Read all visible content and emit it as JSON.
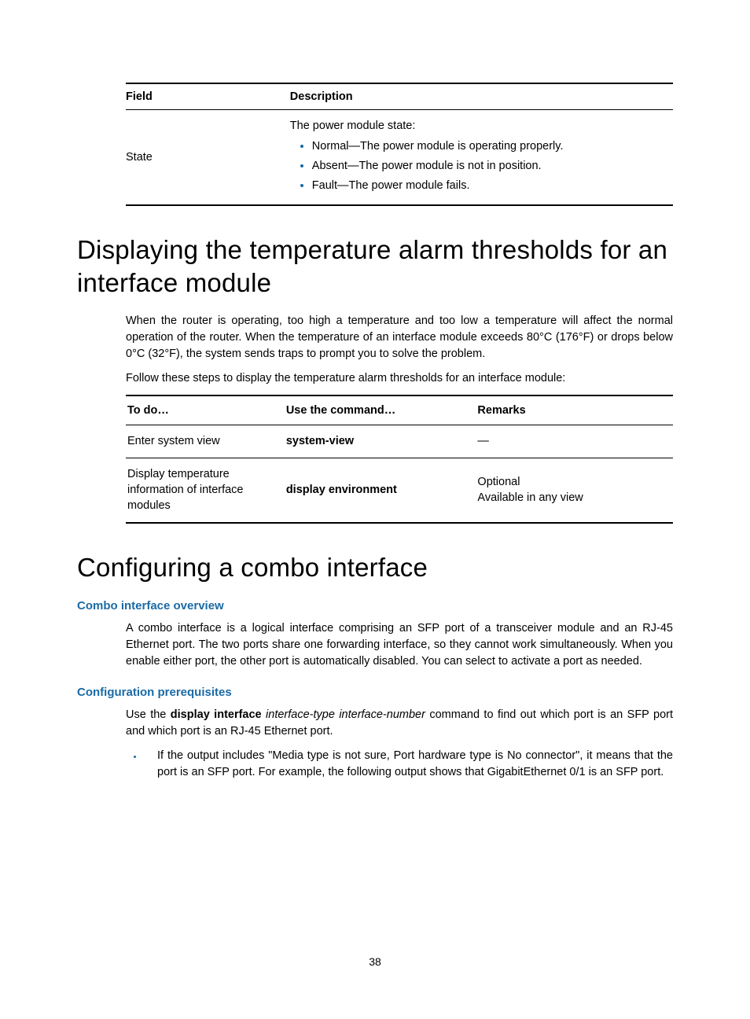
{
  "table1": {
    "headers": {
      "field": "Field",
      "description": "Description"
    },
    "row": {
      "field": "State",
      "intro": "The power module state:",
      "items": [
        "Normal—The power module is operating properly.",
        "Absent—The power module is not in position.",
        "Fault—The power module fails."
      ]
    }
  },
  "h1_temp": "Displaying the temperature alarm thresholds for an interface module",
  "temp_para": "When the router is operating, too high a temperature and too low a temperature will affect the normal operation of the router. When the temperature of an interface module exceeds 80°C (176°F) or drops below 0°C (32°F), the system sends traps to prompt you to solve the problem.",
  "temp_steps_intro": "Follow these steps to display the temperature alarm thresholds for an interface module:",
  "steps": {
    "headers": {
      "todo": "To do…",
      "cmd": "Use the command…",
      "remarks": "Remarks"
    },
    "rows": [
      {
        "todo": "Enter system view",
        "cmd": "system-view",
        "remarks": [
          "—"
        ]
      },
      {
        "todo": "Display temperature information of interface modules",
        "cmd": "display environment",
        "remarks": [
          "Optional",
          "Available in any view"
        ]
      }
    ]
  },
  "h1_combo": "Configuring a combo interface",
  "sub_overview": "Combo interface overview",
  "combo_para": "A combo interface is a logical interface comprising an SFP port of a transceiver module and an RJ-45 Ethernet port. The two ports share one forwarding interface, so they cannot work simultaneously. When you enable either port, the other port is automatically disabled. You can select to activate a port as needed.",
  "sub_prereq": "Configuration prerequisites",
  "prereq_use": "Use the ",
  "prereq_cmd_bold": "display interface",
  "prereq_cmd_italic": " interface-type interface-number",
  "prereq_tail": " command to find out which port is an SFP port and which port is an RJ-45 Ethernet port.",
  "prereq_bullet": "If the output includes \"Media type is not sure, Port hardware type is No connector\", it means that the port is an SFP port. For example, the following output shows that GigabitEthernet 0/1 is an SFP port.",
  "page_number": "38"
}
